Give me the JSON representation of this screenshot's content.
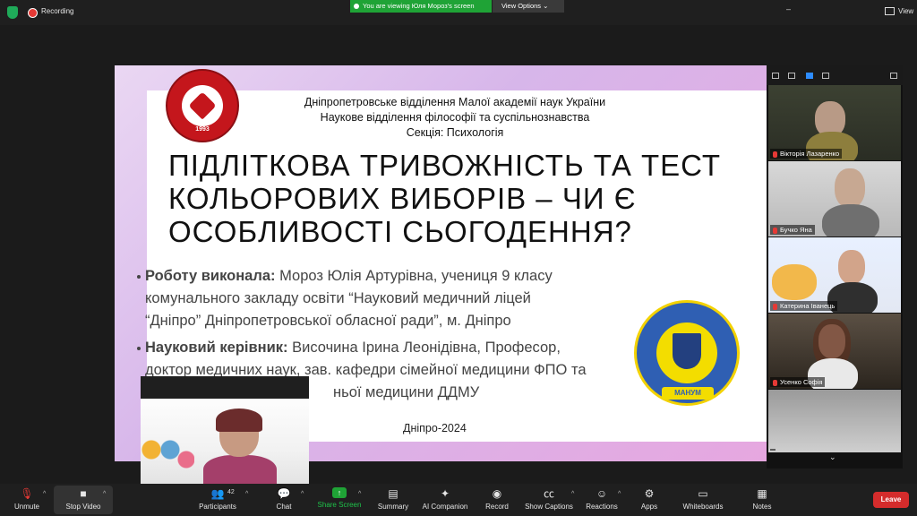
{
  "topbar": {
    "recording_label": "Recording",
    "share_banner": "You are viewing Юля Мороз's screen",
    "view_options": "View Options",
    "view_label": "View"
  },
  "slide": {
    "org_lines": [
      "Дніпропетровське відділення Малої академії наук України",
      "Наукове відділення філософії та суспільнознавства",
      "Секція: Психологія"
    ],
    "logo_year": "1993",
    "title_lines": [
      "ПІДЛІТКОВА ТРИВОЖНІСТЬ ТА ТЕСТ",
      "КОЛЬОРОВИХ ВИБОРІВ – ЧИ Є",
      "ОСОБЛИВОСТІ СЬОГОДЕННЯ?"
    ],
    "author_label": "Роботу виконала:",
    "author_lines": [
      " Мороз Юлія Артурівна, учениця 9 класу",
      "комунального закладу освіти “Науковий медичний ліцей",
      "“Дніпро” Дніпропетровської обласної ради”, м. Дніпро"
    ],
    "advisor_label": "Науковий керівник:",
    "advisor_lines": [
      " Височина Ірина Леонідівна, Професор,",
      "доктор медичних наук, зав. кафедри сімейної медицини ФПО та",
      "ньої медицини ДДМУ"
    ],
    "emblem_text": "МАНУМ",
    "city_year": "Дніпро-2024"
  },
  "gallery": {
    "participants": [
      "Вікторія Лазаренко",
      "Бучко Яна",
      "Катерина Іванець",
      "Усенко Софія",
      ""
    ]
  },
  "toolbar": {
    "unmute": "Unmute",
    "stop_video": "Stop Video",
    "participants": "Participants",
    "participants_count": "42",
    "chat": "Chat",
    "share_screen": "Share Screen",
    "summary": "Summary",
    "ai_companion": "AI Companion",
    "record": "Record",
    "show_captions": "Show Captions",
    "reactions": "Reactions",
    "apps": "Apps",
    "whiteboards": "Whiteboards",
    "notes": "Notes",
    "leave": "Leave"
  },
  "colors": {
    "share_green": "#1fa336",
    "leave_red": "#d42c2c",
    "toolbar_bg": "#1f1f1f"
  }
}
